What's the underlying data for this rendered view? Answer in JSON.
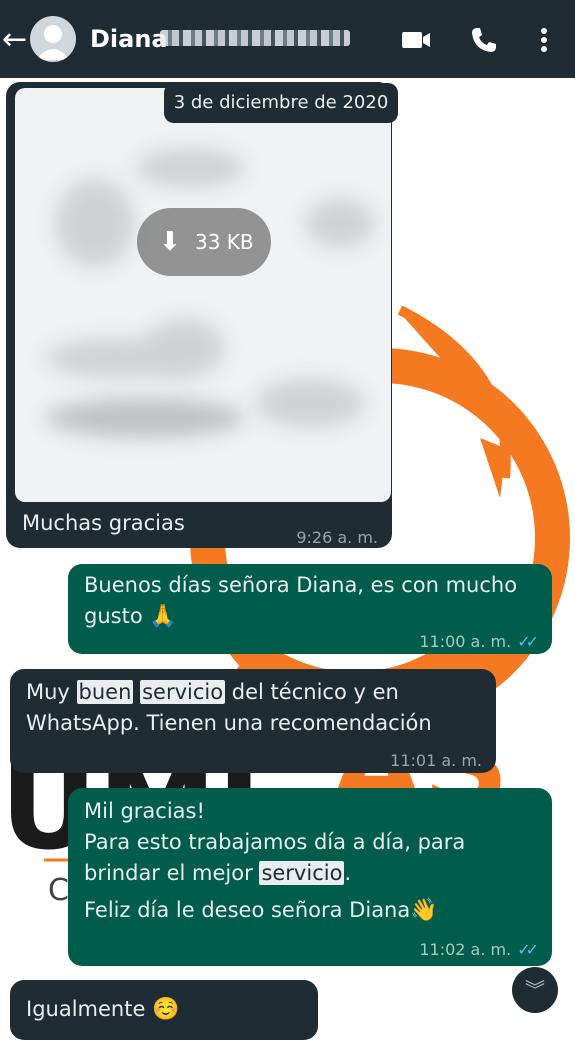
{
  "header": {
    "back_icon": "arrow-left-icon",
    "contact_name": "Diana",
    "icons": [
      "video-call-icon",
      "phone-icon",
      "more-vert-icon"
    ]
  },
  "chat": {
    "date_label": "3 de diciembre de 2020",
    "media": {
      "size": "33 KB",
      "caption": "Muchas gracias",
      "time": "9:26 a. m."
    },
    "messages": [
      {
        "dir": "out",
        "text": "Buenos días señora Diana, es con mucho gusto",
        "emoji": "🙏",
        "time": "11:00 a. m."
      },
      {
        "dir": "in",
        "parts": [
          "Muy",
          "buen",
          "servicio",
          "del técnico y en",
          "WhatsApp. Tienen una recomendación"
        ],
        "time": "11:01 a. m."
      },
      {
        "dir": "out",
        "lines": [
          "Mil gracias!",
          "Para esto trabajamos día a día, para",
          "brindar el mejor",
          "servicio",
          ".",
          "Feliz día le deseo señora Diana"
        ],
        "emoji": "👋",
        "time": "11:02 a. m."
      },
      {
        "dir": "in",
        "text": "Igualmente",
        "emoji": "☺️"
      }
    ]
  },
  "colors": {
    "header_bg": "#1f2c33",
    "incoming_bg": "#1f2c33",
    "outgoing_bg": "#005c4b",
    "read_ticks": "#53bdeb",
    "logo_orange": "#f47920"
  }
}
